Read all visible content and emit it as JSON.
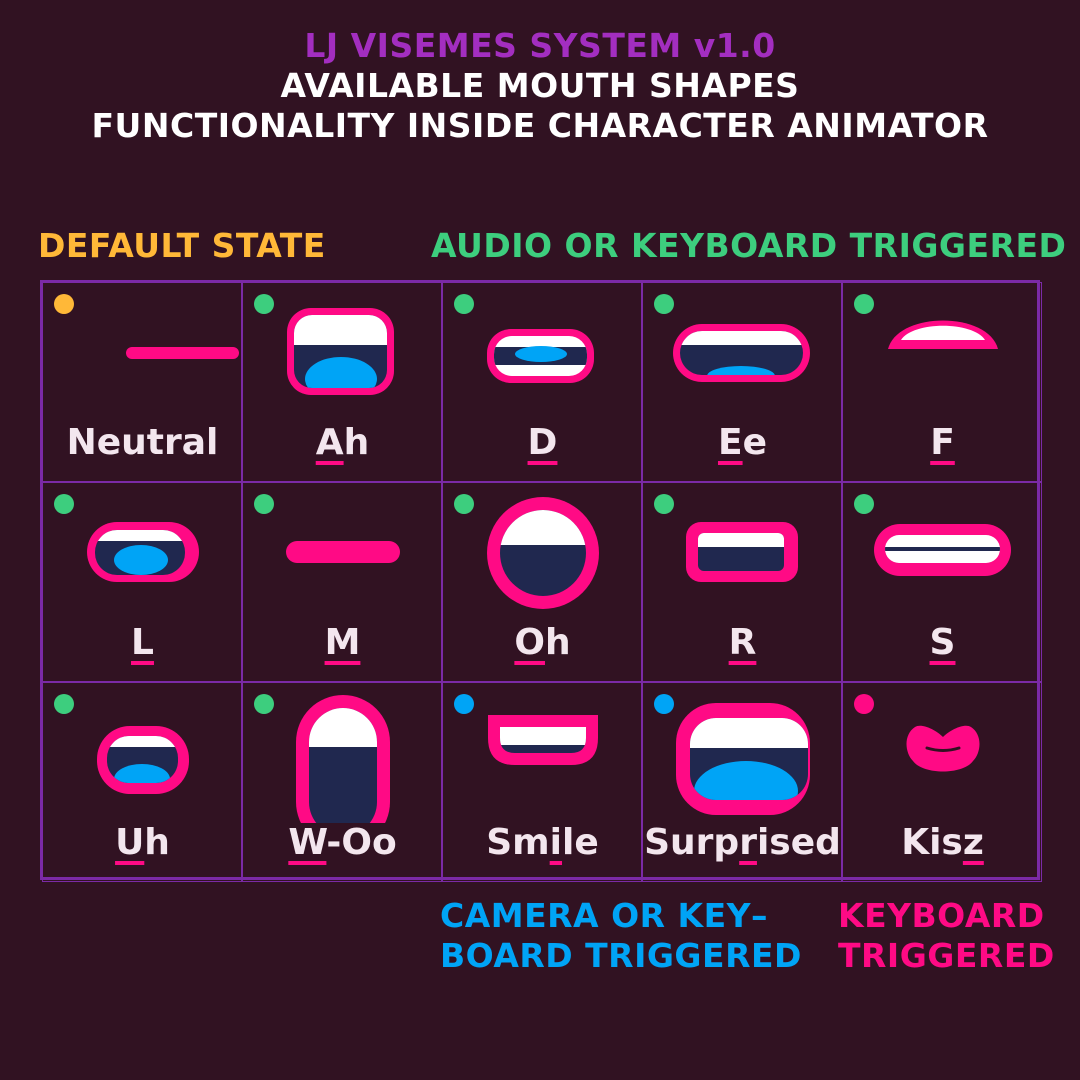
{
  "header": {
    "line1": "LJ VISEMES SYSTEM v1.0",
    "line2": "AVAILABLE MOUTH SHAPES",
    "line3": "FUNCTIONALITY INSIDE CHARACTER ANIMATOR"
  },
  "legend": {
    "default": "DEFAULT STATE",
    "audio": "AUDIO OR KEYBOARD TRIGGERED",
    "camera_line1": "CAMERA OR KEY–",
    "camera_line2": "BOARD TRIGGERED",
    "keyboard_line1": "KEYBOARD",
    "keyboard_line2": "TRIGGERED"
  },
  "colors": {
    "background": "#311222",
    "title_purple": "#a32ec0",
    "grid_border": "#7b2aa6",
    "default": "#ffb838",
    "audio": "#3dce7e",
    "camera": "#00a4f6",
    "keyboard": "#ff0a85",
    "mouth_outline": "#ff0a85",
    "teeth": "#ffffff",
    "mouth_inside": "#20284f",
    "tongue": "#00a4f6",
    "label_text": "#f3e6ee"
  },
  "visemes": [
    {
      "label": "Neutral",
      "key": "",
      "rest": "Neutral",
      "trigger": "default",
      "shape": "neutral"
    },
    {
      "label": "Ah",
      "key": "A",
      "rest": "h",
      "trigger": "audio",
      "shape": "ah"
    },
    {
      "label": "D",
      "key": "D",
      "rest": "",
      "trigger": "audio",
      "shape": "d"
    },
    {
      "label": "Ee",
      "key": "E",
      "rest": "e",
      "trigger": "audio",
      "shape": "ee"
    },
    {
      "label": "F",
      "key": "F",
      "rest": "",
      "trigger": "audio",
      "shape": "f"
    },
    {
      "label": "L",
      "key": "L",
      "rest": "",
      "trigger": "audio",
      "shape": "l"
    },
    {
      "label": "M",
      "key": "M",
      "rest": "",
      "trigger": "audio",
      "shape": "m"
    },
    {
      "label": "Oh",
      "key": "O",
      "rest": "h",
      "trigger": "audio",
      "shape": "oh"
    },
    {
      "label": "R",
      "key": "R",
      "rest": "",
      "trigger": "audio",
      "shape": "r"
    },
    {
      "label": "S",
      "key": "S",
      "rest": "",
      "trigger": "audio",
      "shape": "s"
    },
    {
      "label": "Uh",
      "key": "U",
      "rest": "h",
      "trigger": "audio",
      "shape": "uh"
    },
    {
      "label": "W-Oo",
      "key": "W",
      "rest": "-Oo",
      "trigger": "audio",
      "shape": "woo"
    },
    {
      "label": "Smile",
      "pre": "Sm",
      "key": "i",
      "rest": "le",
      "trigger": "camera",
      "shape": "smile"
    },
    {
      "label": "Surprised",
      "pre": "Surp",
      "key": "r",
      "rest": "ised",
      "trigger": "camera",
      "shape": "surprised"
    },
    {
      "label": "Kisz",
      "pre": "Kis",
      "key": "z",
      "rest": "",
      "trigger": "keyboard",
      "shape": "kisz"
    }
  ]
}
